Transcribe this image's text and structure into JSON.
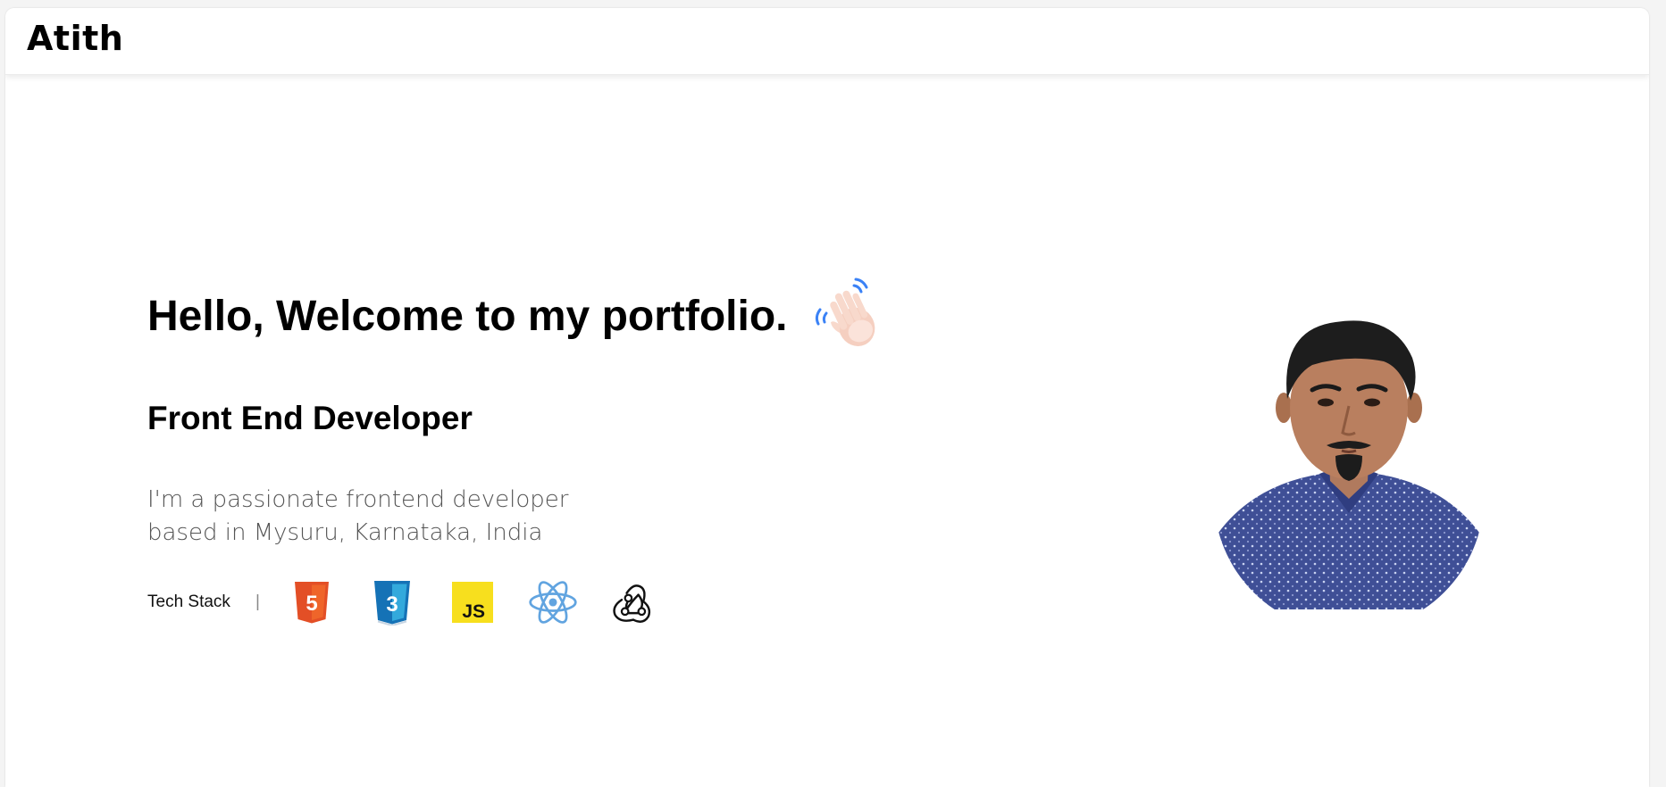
{
  "navbar": {
    "brand": "Atith"
  },
  "hero": {
    "title": "Hello, Welcome to my portfolio.",
    "wave_icon": "waving-hand-icon",
    "role": "Front End Developer",
    "bio_lines": [
      "I'm a passionate frontend developer",
      "based in Mysuru, Karnataka, India"
    ]
  },
  "tech_stack": {
    "label": "Tech Stack",
    "separator": "|",
    "icons": [
      {
        "name": "html5-icon",
        "text": "5",
        "color": "#e34f26"
      },
      {
        "name": "css3-icon",
        "text": "3",
        "color": "#1572b6"
      },
      {
        "name": "javascript-icon",
        "text": "JS",
        "color": "#f7df1e"
      },
      {
        "name": "react-icon",
        "color": "#61a4e0"
      },
      {
        "name": "redux-icon",
        "color": "#111111"
      }
    ]
  },
  "profile": {
    "avatar_icon": "profile-photo"
  },
  "colors": {
    "background": "#ffffff",
    "text": "#000000",
    "muted_text": "#555555"
  }
}
